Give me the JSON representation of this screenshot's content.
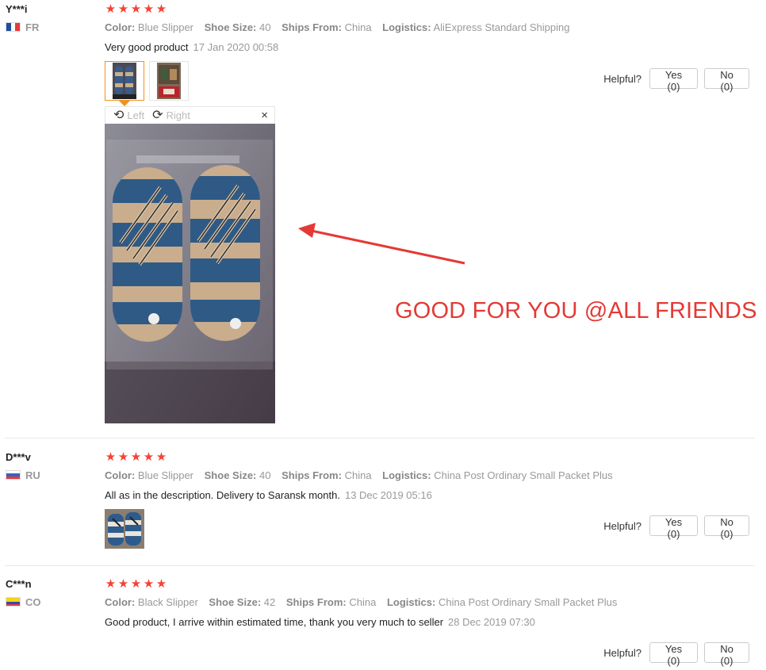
{
  "reviews": [
    {
      "user": "Y***i",
      "country": "FR",
      "stars": [
        "★",
        "★",
        "★",
        "★",
        "★"
      ],
      "props": {
        "color_label": "Color:",
        "color_value": "Blue Slipper",
        "size_label": "Shoe Size:",
        "size_value": "40",
        "ships_label": "Ships From:",
        "ships_value": "China",
        "logistics_label": "Logistics:",
        "logistics_value": "AliExpress Standard Shipping"
      },
      "feedback": "Very good product",
      "date": "17 Jan 2020 00:58",
      "helpful_label": "Helpful?",
      "yes_label": "Yes (0)",
      "no_label": "No (0)"
    },
    {
      "user": "D***v",
      "country": "RU",
      "stars": [
        "★",
        "★",
        "★",
        "★",
        "★"
      ],
      "props": {
        "color_label": "Color:",
        "color_value": "Blue Slipper",
        "size_label": "Shoe Size:",
        "size_value": "40",
        "ships_label": "Ships From:",
        "ships_value": "China",
        "logistics_label": "Logistics:",
        "logistics_value": "China Post Ordinary Small Packet Plus"
      },
      "feedback": "All as in the description. Delivery to Saransk month.",
      "date": "13 Dec 2019 05:16",
      "helpful_label": "Helpful?",
      "yes_label": "Yes (0)",
      "no_label": "No (0)"
    },
    {
      "user": "C***n",
      "country": "CO",
      "stars": [
        "★",
        "★",
        "★",
        "★",
        "★"
      ],
      "props": {
        "color_label": "Color:",
        "color_value": "Black Slipper",
        "size_label": "Shoe Size:",
        "size_value": "42",
        "ships_label": "Ships From:",
        "ships_value": "China",
        "logistics_label": "Logistics:",
        "logistics_value": "China Post Ordinary Small Packet Plus"
      },
      "feedback": "Good product, I arrive within estimated time, thank you very much to seller",
      "date": "28 Dec 2019 07:30",
      "helpful_label": "Helpful?",
      "yes_label": "Yes (0)",
      "no_label": "No (0)"
    }
  ],
  "viewer": {
    "rotate_left_label": "Left",
    "rotate_right_label": "Right",
    "rotate_left_icon": "rotate-left-icon",
    "rotate_right_icon": "rotate-right-icon",
    "close_icon": "close-icon",
    "close_glyph": "×"
  },
  "annotation": {
    "text": "GOOD FOR YOU @ALL FRIENDS",
    "color": "#e53935"
  },
  "colors": {
    "star": "#f44336",
    "active_thumb_border": "#f0921e"
  }
}
